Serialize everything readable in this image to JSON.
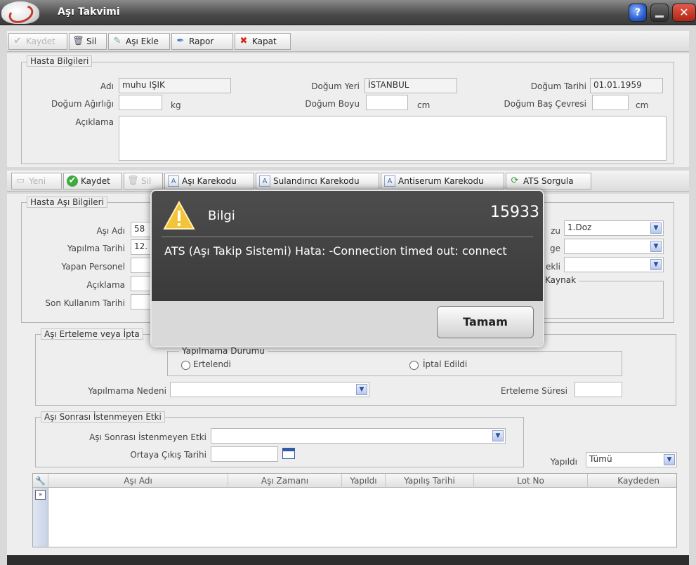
{
  "window": {
    "title": "Aşı Takvimi"
  },
  "toolbar": {
    "save": "Kaydet",
    "delete": "Sil",
    "add_vaccine": "Aşı Ekle",
    "report": "Rapor",
    "close": "Kapat"
  },
  "patient": {
    "legend": "Hasta Bilgileri",
    "name_label": "Adı",
    "name": "muhu IŞIK",
    "birthplace_label": "Doğum Yeri",
    "birthplace": "İSTANBUL",
    "birthdate_label": "Doğum Tarihi",
    "birthdate": "01.01.1959",
    "weight_label": "Doğum Ağırlığı",
    "weight_unit": "kg",
    "height_label": "Doğum Boyu",
    "height_unit": "cm",
    "head_label": "Doğum Baş Çevresi",
    "head_unit": "cm",
    "note_label": "Açıklama"
  },
  "toolbar2": {
    "new": "Yeni",
    "save": "Kaydet",
    "delete": "Sil",
    "vaccine_barcode": "Aşı Karekodu",
    "diluent_barcode": "Sulandırıcı Karekodu",
    "antiserum_barcode": "Antiserum Karekodu",
    "ats_query": "ATS Sorgula"
  },
  "vaccine": {
    "legend": "Hasta Aşı Bilgileri",
    "name_label": "Aşı Adı",
    "name_value": "58",
    "date_label": "Yapılma Tarihi",
    "date_value": "12.",
    "staff_label": "Yapan Personel",
    "note_label": "Açıklama",
    "expiry_label": "Son Kullanım Tarihi",
    "dose_label": "zu",
    "dose_value": "1.Doz",
    "route_label": "ge",
    "method_label": "ekli",
    "source_label": "Kaynak"
  },
  "postpone": {
    "legend": "Aşı Erteleme veya İpta",
    "status_legend": "Yapılmama Durumu",
    "opt_postponed": "Ertelendi",
    "opt_cancelled": "İptal Edildi",
    "reason_label": "Yapılmama Nedeni",
    "duration_label": "Erteleme Süresi"
  },
  "side_effect": {
    "legend": "Aşı Sonrası İstenmeyen Etki",
    "effect_label": "Aşı Sonrası İstenmeyen Etki",
    "onset_label": "Ortaya Çıkış Tarihi"
  },
  "filter": {
    "done_label": "Yapıldı",
    "done_value": "Tümü"
  },
  "table": {
    "columns": [
      "Aşı Adı",
      "Aşı Zamanı",
      "Yapıldı",
      "Yapılış Tarihi",
      "Lot No",
      "Kaydeden"
    ]
  },
  "dialog": {
    "title": "Bilgi",
    "code": "15933",
    "message": "ATS (Aşı Takip Sistemi) Hata: -Connection timed out: connect",
    "ok": "Tamam"
  }
}
